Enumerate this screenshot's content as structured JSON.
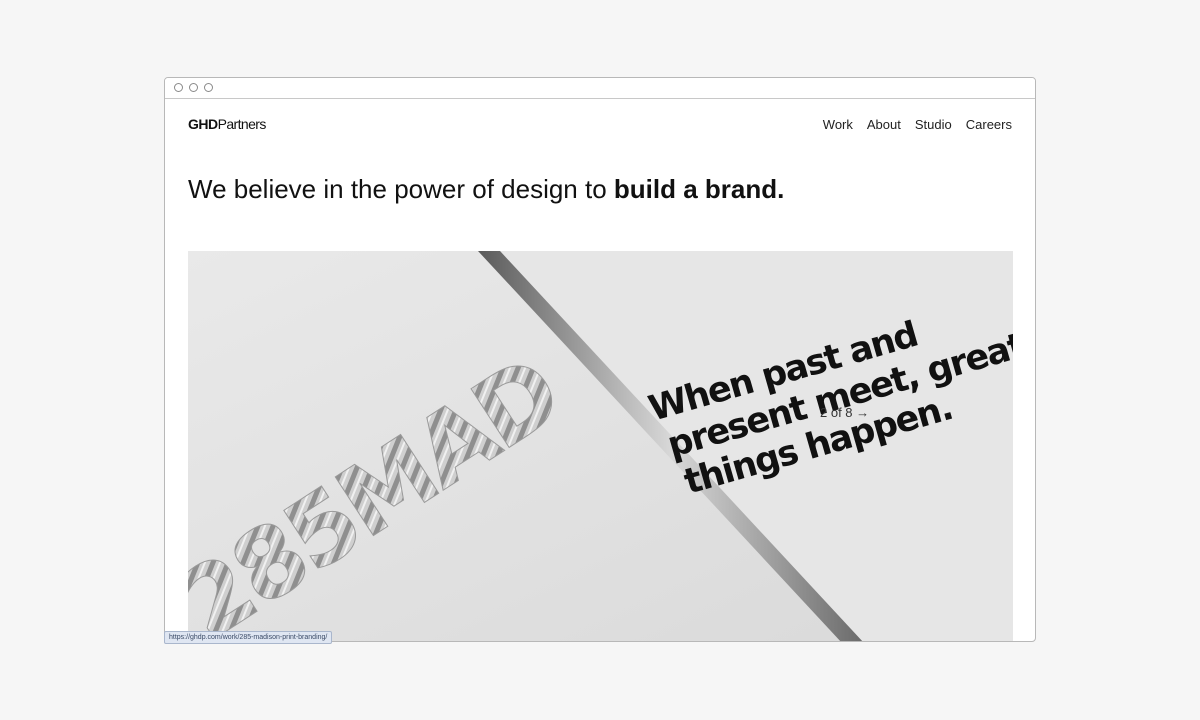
{
  "window": {
    "controls": [
      "close",
      "minimize",
      "zoom"
    ]
  },
  "site": {
    "logo_bold": "GHD",
    "logo_light": "Partners",
    "nav": [
      {
        "label": "Work"
      },
      {
        "label": "About"
      },
      {
        "label": "Studio"
      },
      {
        "label": "Careers"
      }
    ],
    "headline_regular": "We believe in the power of design to ",
    "headline_bold": "build a brand."
  },
  "hero": {
    "quote_lines": [
      "When past and",
      "present meet, great",
      "things happen."
    ],
    "cover_text": "285MAD",
    "counter": "2 of 8 →"
  },
  "statusbar": {
    "url": "https://ghdp.com/work/285-madison-print-branding/"
  }
}
